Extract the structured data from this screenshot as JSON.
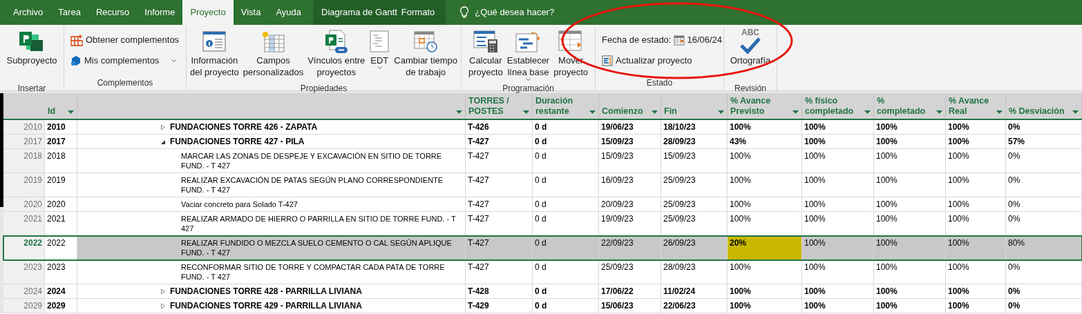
{
  "tabs": [
    {
      "label": "Archivo",
      "selected": false
    },
    {
      "label": "Tarea",
      "selected": false
    },
    {
      "label": "Recurso",
      "selected": false
    },
    {
      "label": "Informe",
      "selected": false
    },
    {
      "label": "Proyecto",
      "selected": true
    },
    {
      "label": "Vista",
      "selected": false
    },
    {
      "label": "Ayuda",
      "selected": false
    }
  ],
  "contextual_group": {
    "label": "Diagrama de Gantt",
    "tabs": [
      {
        "label": "Formato",
        "selected": false
      }
    ]
  },
  "tell_me": {
    "placeholder": "¿Qué desea hacer?"
  },
  "ribbon": {
    "groups": [
      {
        "label": "Insertar",
        "items": [
          {
            "kind": "large",
            "label": "Subproyecto",
            "dropdown": false
          }
        ]
      },
      {
        "label": "Complementos",
        "items": [
          {
            "kind": "small",
            "label": "Obtener complementos",
            "dropdown": false
          },
          {
            "kind": "small",
            "label": "Mis complementos",
            "dropdown": true
          }
        ]
      },
      {
        "label": "Propiedades",
        "items": [
          {
            "kind": "large",
            "label": "Información\ndel proyecto",
            "dropdown": false
          },
          {
            "kind": "large",
            "label": "Campos\npersonalizados",
            "dropdown": false
          },
          {
            "kind": "large",
            "label": "Vínculos entre\nproyectos",
            "dropdown": false
          },
          {
            "kind": "large",
            "label": "EDT",
            "dropdown": true
          },
          {
            "kind": "large",
            "label": "Cambiar tiempo\nde trabajo",
            "dropdown": false
          }
        ]
      },
      {
        "label": "Programación",
        "items": [
          {
            "kind": "large",
            "label": "Calcular\nproyecto",
            "dropdown": false
          },
          {
            "kind": "large",
            "label": "Establecer\nlínea base",
            "dropdown": true
          },
          {
            "kind": "large",
            "label": "Mover\nproyecto",
            "dropdown": false
          }
        ]
      },
      {
        "label": "Estado",
        "items": [
          {
            "kind": "date",
            "label": "Fecha de estado:",
            "value": "16/06/24"
          },
          {
            "kind": "small",
            "label": "Actualizar proyecto",
            "dropdown": false
          }
        ]
      },
      {
        "label": "Revisión",
        "items": [
          {
            "kind": "large",
            "label": "Ortografía",
            "icon_text": "ABC",
            "dropdown": false
          }
        ]
      }
    ]
  },
  "annotations": [
    {
      "kind": "ellipse",
      "color": "#e8140c"
    }
  ],
  "table": {
    "columns": [
      {
        "label": "Id",
        "filter": true
      },
      {
        "filter": true
      },
      {
        "label": "TORRES /\nPOSTES",
        "filter": true
      },
      {
        "label": "Duración\nrestante",
        "filter": true
      },
      {
        "label": "Comienzo",
        "filter": true
      },
      {
        "label": "Fin",
        "filter": true
      },
      {
        "label": "% Avance\nPrevisto",
        "filter": true
      },
      {
        "label": "% físico\ncompletado",
        "filter": true
      },
      {
        "label": "%\ncompletado",
        "filter": true
      },
      {
        "label": "% Avance\nReal",
        "filter": true
      },
      {
        "label": "% Desviación",
        "filter": true
      }
    ],
    "rows": [
      {
        "row_number": "2010",
        "kind": "summary",
        "expanded": false,
        "selected": false,
        "previsto_highlighted": false,
        "cells": [
          "2010",
          "FUNDACIONES TORRE 426 - ZAPATA",
          "T-426",
          "0 d",
          "19/06/23",
          "18/10/23",
          "100%",
          "100%",
          "100%",
          "100%",
          "0%"
        ]
      },
      {
        "row_number": "2017",
        "kind": "summary",
        "expanded": true,
        "selected": false,
        "previsto_highlighted": false,
        "cells": [
          "2017",
          "FUNDACIONES TORRE 427 - PILA",
          "T-427",
          "0 d",
          "15/09/23",
          "28/09/23",
          "43%",
          "100%",
          "100%",
          "100%",
          "57%"
        ]
      },
      {
        "row_number": "2018",
        "kind": "task",
        "selected": false,
        "previsto_highlighted": false,
        "cells": [
          "2018",
          "MARCAR LAS ZONAS DE DESPEJE Y EXCAVACIÓN EN SITIO DE TORRE FUND. - T 427",
          "T-427",
          "0 d",
          "15/09/23",
          "15/09/23",
          "100%",
          "100%",
          "100%",
          "100%",
          "0%"
        ]
      },
      {
        "row_number": "2019",
        "kind": "task",
        "selected": false,
        "previsto_highlighted": false,
        "cells": [
          "2019",
          "REALIZAR EXCAVACIÓN DE PATAS SEGÚN PLANO CORRESPONDIENTE FUND. - T 427",
          "T-427",
          "0 d",
          "16/09/23",
          "25/09/23",
          "100%",
          "100%",
          "100%",
          "100%",
          "0%"
        ]
      },
      {
        "row_number": "2020",
        "kind": "task",
        "selected": false,
        "previsto_highlighted": false,
        "cells": [
          "2020",
          "Vaciar concreto para Solado T-427",
          "T-427",
          "0 d",
          "20/09/23",
          "25/09/23",
          "100%",
          "100%",
          "100%",
          "100%",
          "0%"
        ]
      },
      {
        "row_number": "2021",
        "kind": "task",
        "selected": false,
        "previsto_highlighted": false,
        "cells": [
          "2021",
          "REALIZAR ARMADO DE HIERRO O PARRILLA EN SITIO DE TORRE FUND. - T 427",
          "T-427",
          "0 d",
          "19/09/23",
          "25/09/23",
          "100%",
          "100%",
          "100%",
          "100%",
          "0%"
        ]
      },
      {
        "row_number": "2022",
        "kind": "task",
        "selected": true,
        "previsto_highlighted": true,
        "cells": [
          "2022",
          "REALIZAR FUNDIDO O MEZCLA SUELO CEMENTO O CAL SEGÚN APLIQUE FUND. - T 427",
          "T-427",
          "0 d",
          "22/09/23",
          "26/09/23",
          "20%",
          "100%",
          "100%",
          "100%",
          "80%"
        ]
      },
      {
        "row_number": "2023",
        "kind": "task",
        "selected": false,
        "previsto_highlighted": false,
        "cells": [
          "2023",
          "RECONFORMAR SITIO DE TORRE Y COMPACTAR CADA PATA DE TORRE FUND. - T 427",
          "T-427",
          "0 d",
          "25/09/23",
          "28/09/23",
          "100%",
          "100%",
          "100%",
          "100%",
          "0%"
        ]
      },
      {
        "row_number": "2024",
        "kind": "summary",
        "expanded": false,
        "selected": false,
        "previsto_highlighted": false,
        "cells": [
          "2024",
          "FUNDACIONES TORRE 428 - PARRILLA LIVIANA",
          "T-428",
          "0 d",
          "17/06/22",
          "11/02/24",
          "100%",
          "100%",
          "100%",
          "100%",
          "0%"
        ]
      },
      {
        "row_number": "2029",
        "kind": "summary",
        "expanded": false,
        "selected": false,
        "previsto_highlighted": false,
        "cells": [
          "2029",
          "FUNDACIONES TORRE 429 - PARRILLA LIVIANA",
          "T-429",
          "0 d",
          "15/06/23",
          "22/06/23",
          "100%",
          "100%",
          "100%",
          "100%",
          "0%"
        ]
      }
    ]
  }
}
